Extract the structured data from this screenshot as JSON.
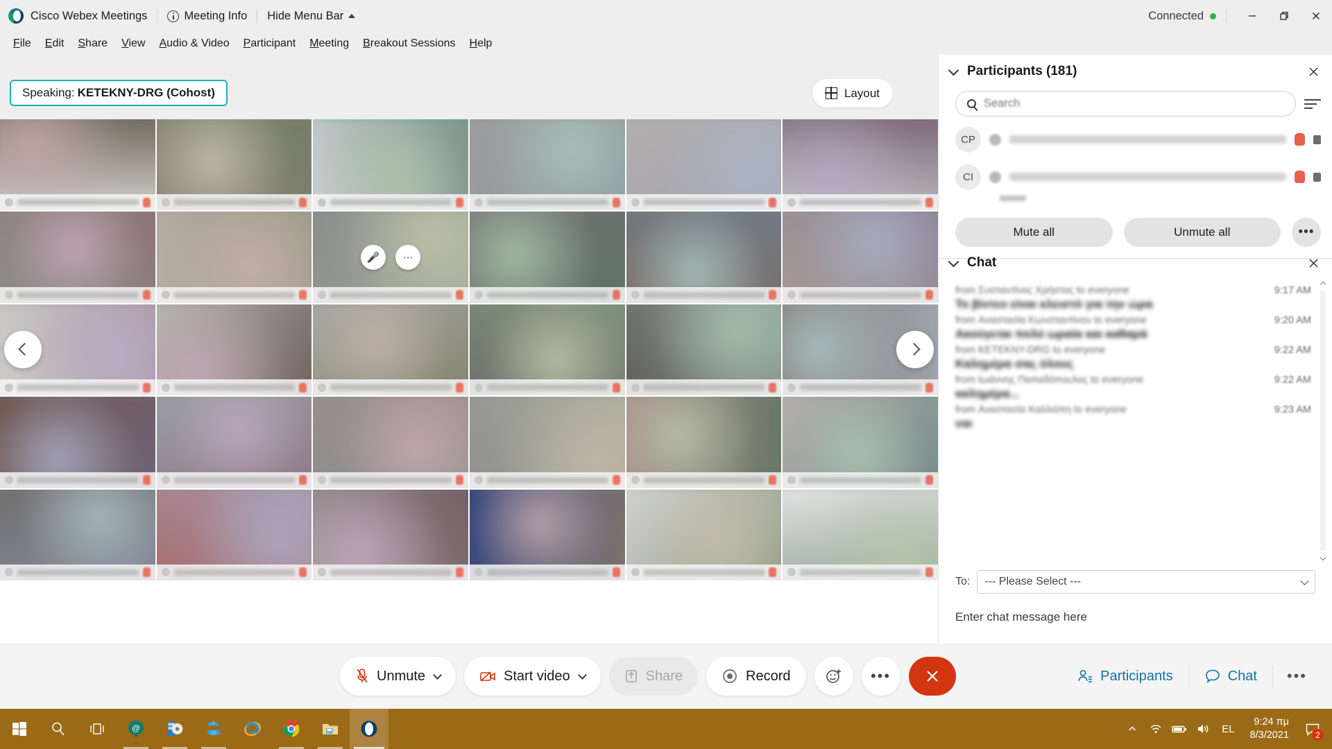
{
  "window": {
    "app_title": "Cisco Webex Meetings",
    "meeting_info_label": "Meeting Info",
    "hide_menu_bar_label": "Hide Menu Bar",
    "connection_status": "Connected",
    "connection_color": "#2bb34b",
    "minimize_label": "Minimize",
    "restore_label": "Restore",
    "close_label": "Close"
  },
  "menubar": {
    "items": [
      {
        "label": "File",
        "accel": "F"
      },
      {
        "label": "Edit",
        "accel": "E"
      },
      {
        "label": "Share",
        "accel": "S"
      },
      {
        "label": "View",
        "accel": "V"
      },
      {
        "label": "Audio & Video",
        "accel": "A"
      },
      {
        "label": "Participant",
        "accel": "P"
      },
      {
        "label": "Meeting",
        "accel": "M"
      },
      {
        "label": "Breakout Sessions",
        "accel": "B"
      },
      {
        "label": "Help",
        "accel": "H"
      }
    ]
  },
  "stage": {
    "speaking_prefix": "Speaking:",
    "speaking_name": "KETEKNY-DRG (Cohost)",
    "layout_label": "Layout",
    "active_speaker_border_color": "#18b0c8",
    "prev_page_label": "Previous page",
    "next_page_label": "Next page"
  },
  "participants": {
    "title": "Participants (181)",
    "count": 181,
    "search_placeholder": "Search",
    "search_value": "",
    "rows": [
      {
        "initials": "CP",
        "name": "",
        "muted": true,
        "locked": true
      },
      {
        "initials": "CI",
        "name": "",
        "muted": true,
        "locked": true
      }
    ],
    "mute_all_label": "Mute all",
    "unmute_all_label": "Unmute all",
    "more_label": "•••",
    "close_label": "Close participants panel"
  },
  "chat": {
    "title": "Chat",
    "close_label": "Close chat panel",
    "messages": [
      {
        "from": "from Συσταντίνος Χρήστος to everyone",
        "time": "9:17 AM",
        "text": "Το βίντεο είναι κλειστό για την ώρα"
      },
      {
        "from": "from Αναστασία Κωνσταντίνου to everyone",
        "time": "9:20 AM",
        "text": "Ακούγεται πολύ ωραία και καθαρά"
      },
      {
        "from": "from KETEKNY-DRG to everyone",
        "time": "9:22 AM",
        "text": "Καλημέρα σας όλους"
      },
      {
        "from": "from Ιωάννης Παπαδόπουλος to everyone",
        "time": "9:22 AM",
        "text": "καλημέρα..."
      },
      {
        "from": "from Αναστασία Καλλιόπη to everyone",
        "time": "9:23 AM",
        "text": "ναι"
      }
    ],
    "to_label": "To:",
    "to_value": "--- Please Select ---",
    "input_placeholder": "Enter chat message here"
  },
  "toolbar": {
    "unmute_label": "Unmute",
    "start_video_label": "Start video",
    "share_label": "Share",
    "record_label": "Record",
    "reactions_label": "Reactions",
    "more_options_label": "•••",
    "leave_label": "Leave meeting",
    "participants_label": "Participants",
    "chat_label": "Chat",
    "right_more_label": "•••",
    "leave_color": "#d2350f",
    "accent_blue": "#1071a8"
  },
  "taskbar": {
    "background": "#9a6a16",
    "items": [
      {
        "name": "start",
        "label": "Start"
      },
      {
        "name": "search",
        "label": "Search"
      },
      {
        "name": "task-view",
        "label": "Task View"
      },
      {
        "name": "mail",
        "label": "Mail"
      },
      {
        "name": "media",
        "label": "Media Player"
      },
      {
        "name": "teams",
        "label": "Teams"
      },
      {
        "name": "internet-explorer",
        "label": "Internet Explorer"
      },
      {
        "name": "chrome",
        "label": "Google Chrome"
      },
      {
        "name": "file-explorer",
        "label": "File Explorer"
      },
      {
        "name": "webex",
        "label": "Cisco Webex Meetings"
      }
    ],
    "language": "EL",
    "time": "9:24 πμ",
    "date": "8/3/2021",
    "notification_count": "2"
  },
  "video_grid": {
    "tiles": [
      {
        "row": 1,
        "col": 1,
        "bg": "#d8d6d2",
        "active": false
      },
      {
        "row": 1,
        "col": 2,
        "bg": "#8d7f74",
        "active": false
      },
      {
        "row": 1,
        "col": 3,
        "bg": "#cfd3d6",
        "active": true
      },
      {
        "row": 1,
        "col": 4,
        "bg": "#9d9d9d",
        "active": false
      },
      {
        "row": 1,
        "col": 5,
        "bg": "#b3b0ad",
        "active": false
      },
      {
        "row": 1,
        "col": 6,
        "bg": "#c8c8c8",
        "active": false
      },
      {
        "row": 2,
        "col": 1,
        "bg": "#8e8f8a",
        "active": false
      },
      {
        "row": 2,
        "col": 2,
        "bg": "#b8aea6",
        "active": false
      },
      {
        "row": 2,
        "col": 3,
        "bg": "#8b8b8b",
        "active": false
      },
      {
        "row": 2,
        "col": 4,
        "bg": "#6e6f6b",
        "active": false
      },
      {
        "row": 2,
        "col": 5,
        "bg": "#7b6a62",
        "active": false
      },
      {
        "row": 2,
        "col": 6,
        "bg": "#a89a93",
        "active": false
      },
      {
        "row": 3,
        "col": 1,
        "bg": "#cfcfcb",
        "active": false
      },
      {
        "row": 3,
        "col": 2,
        "bg": "#b9bcb6",
        "active": false
      },
      {
        "row": 3,
        "col": 3,
        "bg": "#a8a9a5",
        "active": false
      },
      {
        "row": 3,
        "col": 4,
        "bg": "#6d6e6a",
        "active": false
      },
      {
        "row": 3,
        "col": 5,
        "bg": "#5e5a56",
        "active": false
      },
      {
        "row": 3,
        "col": 6,
        "bg": "#7a6f68",
        "active": false
      },
      {
        "row": 4,
        "col": 1,
        "bg": "#6b5246",
        "active": false
      },
      {
        "row": 4,
        "col": 2,
        "bg": "#9aa0a4",
        "active": false
      },
      {
        "row": 4,
        "col": 3,
        "bg": "#8d8d8d",
        "active": false
      },
      {
        "row": 4,
        "col": 4,
        "bg": "#8e8f8b",
        "active": false
      },
      {
        "row": 4,
        "col": 5,
        "bg": "#b08e8e",
        "active": false
      },
      {
        "row": 4,
        "col": 6,
        "bg": "#b9b2ac",
        "active": false
      },
      {
        "row": 5,
        "col": 1,
        "bg": "#6f6e6c",
        "active": false
      },
      {
        "row": 5,
        "col": 2,
        "bg": "#a86b6b",
        "active": false
      },
      {
        "row": 5,
        "col": 3,
        "bg": "#9b978f",
        "active": false
      },
      {
        "row": 5,
        "col": 4,
        "bg": "#2f3f7e",
        "active": false
      },
      {
        "row": 5,
        "col": 5,
        "bg": "#d6d6d6",
        "active": false
      },
      {
        "row": 5,
        "col": 6,
        "bg": "#e6e6e6",
        "active": false
      }
    ]
  }
}
